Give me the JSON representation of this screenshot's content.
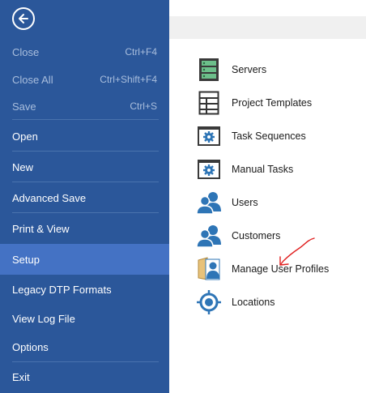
{
  "sidebar": {
    "items": [
      {
        "label": "Close",
        "shortcut": "Ctrl+F4",
        "state": "disabled"
      },
      {
        "label": "Close All",
        "shortcut": "Ctrl+Shift+F4",
        "state": "disabled"
      },
      {
        "label": "Save",
        "shortcut": "Ctrl+S",
        "state": "disabled"
      },
      {
        "label": "Open",
        "shortcut": "",
        "state": "normal"
      },
      {
        "label": "New",
        "shortcut": "",
        "state": "normal"
      },
      {
        "label": "Advanced Save",
        "shortcut": "",
        "state": "normal"
      },
      {
        "label": "Print & View",
        "shortcut": "",
        "state": "normal"
      },
      {
        "label": "Setup",
        "shortcut": "",
        "state": "selected"
      },
      {
        "label": "Legacy DTP Formats",
        "shortcut": "",
        "state": "normal"
      },
      {
        "label": "View Log File",
        "shortcut": "",
        "state": "normal"
      },
      {
        "label": "Options",
        "shortcut": "",
        "state": "normal"
      },
      {
        "label": "Exit",
        "shortcut": "",
        "state": "normal"
      }
    ]
  },
  "setup": {
    "items": [
      {
        "label": "Servers",
        "icon": "server-icon"
      },
      {
        "label": "Project Templates",
        "icon": "template-icon"
      },
      {
        "label": "Task Sequences",
        "icon": "task-sequence-icon"
      },
      {
        "label": "Manual Tasks",
        "icon": "manual-task-icon"
      },
      {
        "label": "Users",
        "icon": "users-icon"
      },
      {
        "label": "Customers",
        "icon": "customers-icon"
      },
      {
        "label": "Manage User Profiles",
        "icon": "user-profile-icon"
      },
      {
        "label": "Locations",
        "icon": "location-target-icon"
      }
    ]
  },
  "colors": {
    "sidebar_bg": "#2b579a",
    "selected_bg": "#4472c4",
    "disabled_text": "#a9bedd",
    "icon_blue": "#2e75b6",
    "annotation_red": "#e02020"
  }
}
